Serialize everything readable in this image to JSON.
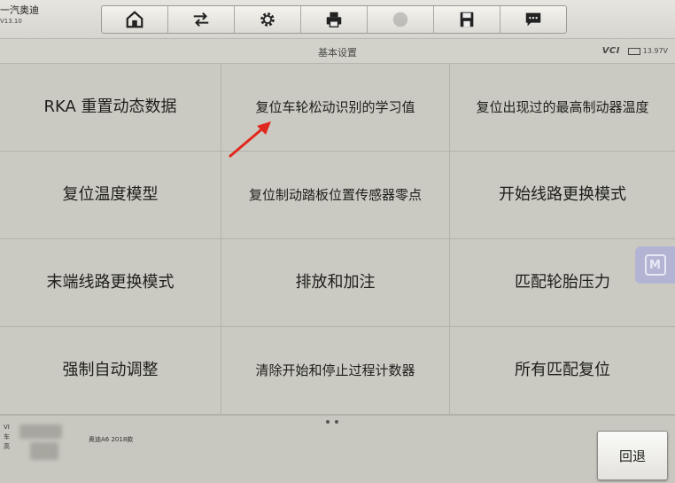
{
  "brand": {
    "title": "一汽奥迪",
    "version": "V13.10"
  },
  "toolbar": {
    "icons": [
      "home-icon",
      "vehicle-swap-icon",
      "settings-icon",
      "print-icon",
      "help-icon",
      "save-icon",
      "message-icon"
    ]
  },
  "header": {
    "title": "基本设置",
    "vci_label": "VCI",
    "battery_voltage": "13.97V"
  },
  "functions": [
    "RKA 重置动态数据",
    "复位车轮松动识别的学习值",
    "复位出现过的最高制动器温度",
    "复位温度模型",
    "复位制动踏板位置传感器零点",
    "开始线路更换模式",
    "末端线路更换模式",
    "排放和加注",
    "匹配轮胎压力",
    "强制自动调整",
    "清除开始和停止过程计数器",
    "所有匹配复位"
  ],
  "footer": {
    "info_prefix_1": "VI",
    "info_prefix_2": "车",
    "info_prefix_3": "高",
    "vehicle": "奥迪A6 2018款",
    "back_label": "回退"
  },
  "float_button": {
    "label": "M"
  }
}
